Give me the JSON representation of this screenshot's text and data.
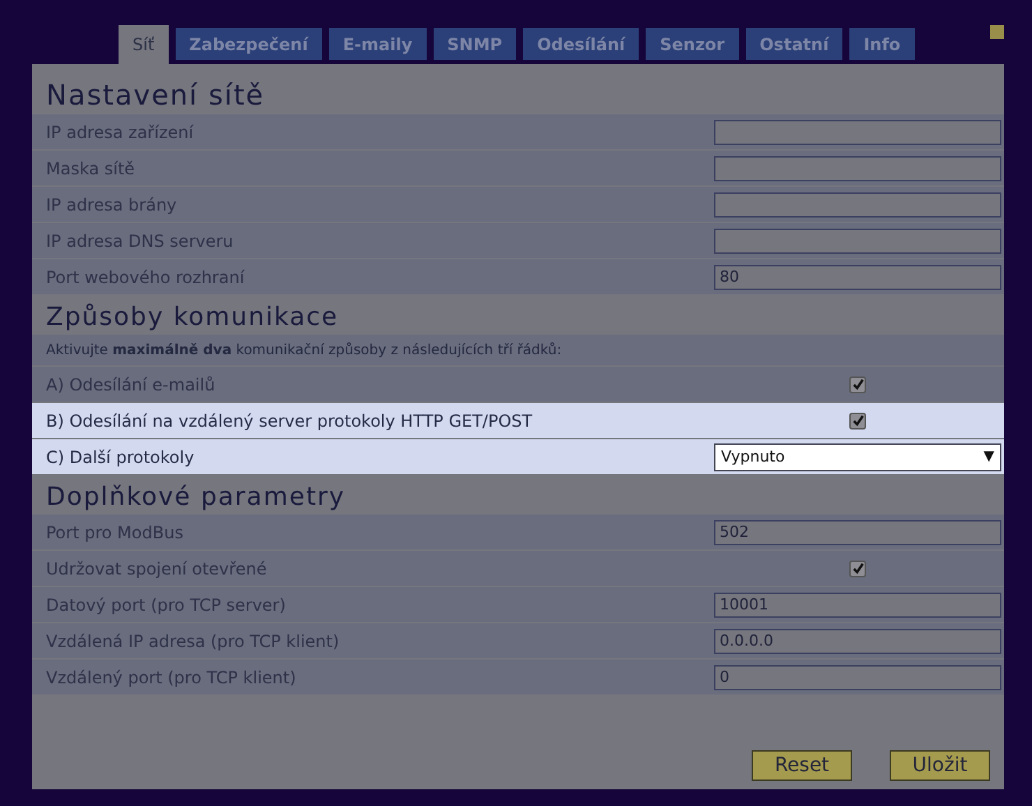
{
  "tabs": [
    {
      "label": "Síť",
      "selected": true
    },
    {
      "label": "Zabezpečení",
      "selected": false
    },
    {
      "label": "E-maily",
      "selected": false
    },
    {
      "label": "SNMP",
      "selected": false
    },
    {
      "label": "Odesílání",
      "selected": false
    },
    {
      "label": "Senzor",
      "selected": false
    },
    {
      "label": "Ostatní",
      "selected": false
    },
    {
      "label": "Info",
      "selected": false
    }
  ],
  "sections": [
    {
      "title": "Nastavení sítě",
      "rows": [
        {
          "kind": "input",
          "label": "IP adresa zařízení",
          "highlighted": false
        },
        {
          "kind": "input",
          "label": "Maska sítě",
          "highlighted": false
        },
        {
          "kind": "input",
          "label": "IP adresa brány",
          "highlighted": false
        },
        {
          "kind": "input",
          "label": "IP adresa DNS serveru",
          "highlighted": false
        },
        {
          "kind": "input",
          "label": "Port webového rozhraní",
          "value": "80",
          "highlighted": false
        }
      ]
    },
    {
      "title": "Způsoby komunikace",
      "note": "Aktivujte **maximálně dva** komunikační způsoby z následujících tří řádků:",
      "rows": [
        {
          "kind": "checkbox",
          "label": "A) Odesílání e-mailů",
          "checked": true,
          "highlighted": false
        },
        {
          "kind": "checkbox",
          "label": "B) Odesílání na vzdálený server protokoly HTTP GET/POST",
          "checked": true,
          "highlighted": true
        },
        {
          "kind": "select",
          "label": "C) Další protokoly",
          "value": "Vypnuto",
          "arrow": "▼",
          "highlighted": true
        }
      ]
    },
    {
      "title": "Doplňkové parametry",
      "rows": [
        {
          "kind": "input",
          "label": "Port pro ModBus",
          "value": "502",
          "highlighted": false
        },
        {
          "kind": "checkbox",
          "label": "Udržovat spojení otevřené",
          "checked": true,
          "highlighted": false
        },
        {
          "kind": "input",
          "label": "Datový port (pro TCP server)",
          "value": "10001",
          "highlighted": false
        },
        {
          "kind": "input",
          "label": "Vzdálená IP adresa (pro TCP klient)",
          "value": "0.0.0.0",
          "highlighted": false
        },
        {
          "kind": "input",
          "label": "Vzdálený port (pro TCP klient)",
          "value": "0",
          "highlighted": false
        }
      ]
    }
  ],
  "buttons": [
    "Reset",
    "Uložit"
  ]
}
